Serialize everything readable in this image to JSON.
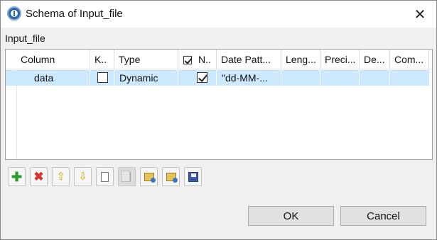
{
  "window": {
    "title": "Schema of Input_file",
    "close_glyph": "✕"
  },
  "group_label": "Input_file",
  "table": {
    "columns": [
      "Column",
      "K..",
      "Type",
      "N..",
      "Date Patt...",
      "Leng...",
      "Preci...",
      "De...",
      "Com..."
    ],
    "rows": [
      {
        "column": "data",
        "key": false,
        "type": "Dynamic",
        "nullable": true,
        "date_pattern": "\"dd-MM-...",
        "length": "",
        "precision": "",
        "default": "",
        "comment": ""
      }
    ],
    "selected_row_color": "#cce8ff"
  },
  "toolbar": {
    "buttons": [
      {
        "name": "add-icon",
        "glyph": "✚",
        "enabled": true
      },
      {
        "name": "remove-icon",
        "glyph": "✖",
        "enabled": true
      },
      {
        "name": "move-up-icon",
        "glyph": "⇧",
        "enabled": true
      },
      {
        "name": "move-down-icon",
        "glyph": "⇩",
        "enabled": true
      },
      {
        "name": "copy-icon",
        "enabled": true
      },
      {
        "name": "paste-icon",
        "enabled": false
      },
      {
        "name": "import-icon",
        "enabled": true
      },
      {
        "name": "export-icon",
        "enabled": true
      },
      {
        "name": "save-icon",
        "enabled": true
      }
    ]
  },
  "buttons": {
    "ok": "OK",
    "cancel": "Cancel"
  }
}
